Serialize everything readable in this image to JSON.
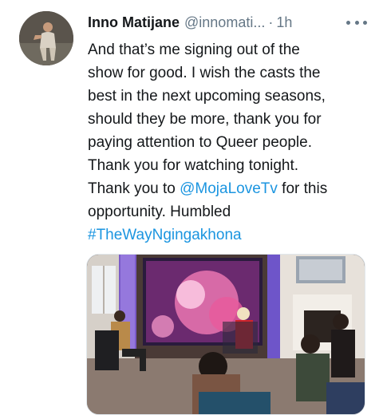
{
  "tweet": {
    "author_name": "Inno Matijane",
    "author_handle": "@innomati...",
    "separator": "·",
    "time": "1h",
    "text_lines": [
      "And that’s me signing out of the",
      "show for good. I wish the casts the",
      "best in the next upcoming seasons,",
      "should they be more, thank you for",
      "paying attention to Queer people.",
      "Thank you for watching tonight."
    ],
    "line7_prefix": "Thank you to ",
    "mention": "@MojaLoveTv",
    "line7_suffix": " for this",
    "line8": "opportunity. Humbled",
    "hashtag": "#TheWayNgingakhona"
  },
  "icons": {
    "more": "more-options-icon"
  },
  "colors": {
    "link": "#1b95e0",
    "text": "#14171a",
    "muted": "#657786"
  }
}
